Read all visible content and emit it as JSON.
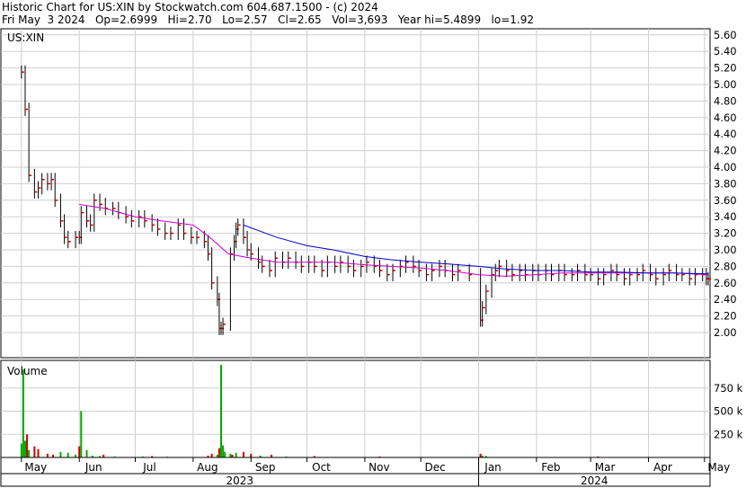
{
  "header": {
    "title_line": "Historic Chart for US:XIN by Stockwatch.com 604.687.1500 - (c) 2024",
    "quote_line": "Fri May  3 2024   Op=2.6999   Hi=2.70   Lo=2.57   Cl=2.65   Vol=3,693   Year hi=5.4899   lo=1.92"
  },
  "chart_data": [
    {
      "type": "line",
      "panel": "price",
      "title": "US:XIN",
      "ylim": [
        1.8,
        5.7
      ],
      "yticks": [
        "5.60",
        "5.40",
        "5.20",
        "5.00",
        "4.80",
        "4.60",
        "4.40",
        "4.20",
        "4.00",
        "3.80",
        "3.60",
        "3.40",
        "3.20",
        "3.00",
        "2.80",
        "2.60",
        "2.40",
        "2.20",
        "2.00"
      ],
      "grid": true,
      "x_months": [
        "May",
        "Jun",
        "Jul",
        "Aug",
        "Sep",
        "Oct",
        "Nov",
        "Dec",
        "Jan",
        "Feb",
        "Mar",
        "Apr",
        "May"
      ],
      "x_years": [
        "2023",
        "2024"
      ],
      "price_points": [
        [
          "2023-05-01",
          5.15
        ],
        [
          "2023-05-03",
          4.7
        ],
        [
          "2023-05-05",
          3.9
        ],
        [
          "2023-05-08",
          3.7
        ],
        [
          "2023-05-10",
          3.75
        ],
        [
          "2023-05-12",
          3.85
        ],
        [
          "2023-05-15",
          3.8
        ],
        [
          "2023-05-17",
          3.85
        ],
        [
          "2023-05-19",
          3.6
        ],
        [
          "2023-05-22",
          3.35
        ],
        [
          "2023-05-24",
          3.15
        ],
        [
          "2023-05-26",
          3.1
        ],
        [
          "2023-05-30",
          3.15
        ],
        [
          "2023-06-01",
          3.15
        ],
        [
          "2023-06-02",
          3.45
        ],
        [
          "2023-06-05",
          3.35
        ],
        [
          "2023-06-07",
          3.3
        ],
        [
          "2023-06-09",
          3.6
        ],
        [
          "2023-06-12",
          3.55
        ],
        [
          "2023-06-15",
          3.5
        ],
        [
          "2023-06-19",
          3.5
        ],
        [
          "2023-06-22",
          3.45
        ],
        [
          "2023-06-26",
          3.4
        ],
        [
          "2023-06-29",
          3.35
        ],
        [
          "2023-07-03",
          3.4
        ],
        [
          "2023-07-06",
          3.35
        ],
        [
          "2023-07-10",
          3.3
        ],
        [
          "2023-07-13",
          3.25
        ],
        [
          "2023-07-17",
          3.2
        ],
        [
          "2023-07-20",
          3.2
        ],
        [
          "2023-07-24",
          3.3
        ],
        [
          "2023-07-27",
          3.2
        ],
        [
          "2023-07-31",
          3.15
        ],
        [
          "2023-08-03",
          3.15
        ],
        [
          "2023-08-07",
          3.1
        ],
        [
          "2023-08-09",
          2.95
        ],
        [
          "2023-08-11",
          2.6
        ],
        [
          "2023-08-14",
          2.4
        ],
        [
          "2023-08-15",
          2.05
        ],
        [
          "2023-08-16",
          2.05
        ],
        [
          "2023-08-17",
          2.1
        ],
        [
          "2023-08-21",
          2.95
        ],
        [
          "2023-08-23",
          3.1
        ],
        [
          "2023-08-24",
          3.25
        ],
        [
          "2023-08-25",
          3.3
        ],
        [
          "2023-08-28",
          3.15
        ],
        [
          "2023-08-30",
          3.0
        ],
        [
          "2023-09-01",
          2.95
        ],
        [
          "2023-09-05",
          2.85
        ],
        [
          "2023-09-07",
          2.8
        ],
        [
          "2023-09-11",
          2.75
        ],
        [
          "2023-09-14",
          2.9
        ],
        [
          "2023-09-18",
          2.85
        ],
        [
          "2023-09-21",
          2.9
        ],
        [
          "2023-09-25",
          2.85
        ],
        [
          "2023-09-28",
          2.8
        ],
        [
          "2023-10-02",
          2.85
        ],
        [
          "2023-10-05",
          2.8
        ],
        [
          "2023-10-09",
          2.75
        ],
        [
          "2023-10-12",
          2.85
        ],
        [
          "2023-10-16",
          2.8
        ],
        [
          "2023-10-19",
          2.85
        ],
        [
          "2023-10-23",
          2.8
        ],
        [
          "2023-10-26",
          2.75
        ],
        [
          "2023-10-30",
          2.8
        ],
        [
          "2023-11-02",
          2.85
        ],
        [
          "2023-11-06",
          2.8
        ],
        [
          "2023-11-09",
          2.75
        ],
        [
          "2023-11-13",
          2.7
        ],
        [
          "2023-11-16",
          2.75
        ],
        [
          "2023-11-20",
          2.8
        ],
        [
          "2023-11-23",
          2.85
        ],
        [
          "2023-11-27",
          2.8
        ],
        [
          "2023-11-30",
          2.75
        ],
        [
          "2023-12-04",
          2.7
        ],
        [
          "2023-12-07",
          2.75
        ],
        [
          "2023-12-11",
          2.8
        ],
        [
          "2023-12-14",
          2.75
        ],
        [
          "2023-12-18",
          2.7
        ],
        [
          "2023-12-21",
          2.75
        ],
        [
          "2023-12-27",
          2.7
        ],
        [
          "2024-01-02",
          2.15
        ],
        [
          "2024-01-03",
          2.3
        ],
        [
          "2024-01-05",
          2.5
        ],
        [
          "2024-01-08",
          2.7
        ],
        [
          "2024-01-10",
          2.75
        ],
        [
          "2024-01-12",
          2.8
        ],
        [
          "2024-01-16",
          2.75
        ],
        [
          "2024-01-19",
          2.7
        ],
        [
          "2024-01-23",
          2.75
        ],
        [
          "2024-01-26",
          2.7
        ],
        [
          "2024-01-30",
          2.75
        ],
        [
          "2024-02-02",
          2.7
        ],
        [
          "2024-02-06",
          2.75
        ],
        [
          "2024-02-09",
          2.7
        ],
        [
          "2024-02-13",
          2.75
        ],
        [
          "2024-02-16",
          2.7
        ],
        [
          "2024-02-20",
          2.7
        ],
        [
          "2024-02-23",
          2.75
        ],
        [
          "2024-02-27",
          2.7
        ],
        [
          "2024-03-01",
          2.7
        ],
        [
          "2024-03-05",
          2.65
        ],
        [
          "2024-03-08",
          2.7
        ],
        [
          "2024-03-12",
          2.75
        ],
        [
          "2024-03-15",
          2.7
        ],
        [
          "2024-03-19",
          2.65
        ],
        [
          "2024-03-22",
          2.7
        ],
        [
          "2024-03-26",
          2.7
        ],
        [
          "2024-03-29",
          2.75
        ],
        [
          "2024-04-02",
          2.7
        ],
        [
          "2024-04-05",
          2.65
        ],
        [
          "2024-04-09",
          2.7
        ],
        [
          "2024-04-12",
          2.75
        ],
        [
          "2024-04-16",
          2.7
        ],
        [
          "2024-04-19",
          2.7
        ],
        [
          "2024-04-23",
          2.65
        ],
        [
          "2024-04-26",
          2.7
        ],
        [
          "2024-04-30",
          2.7
        ],
        [
          "2024-05-02",
          2.65
        ],
        [
          "2024-05-03",
          2.65
        ]
      ],
      "series": [
        {
          "color": "#cc00cc",
          "values": [
            [
              "2023-06-01",
              3.55
            ],
            [
              "2023-06-15",
              3.5
            ],
            [
              "2023-07-01",
              3.4
            ],
            [
              "2023-07-15",
              3.35
            ],
            [
              "2023-08-01",
              3.3
            ],
            [
              "2023-08-10",
              3.15
            ],
            [
              "2023-08-20",
              2.95
            ],
            [
              "2023-09-01",
              2.9
            ],
            [
              "2023-09-15",
              2.85
            ],
            [
              "2023-10-01",
              2.85
            ],
            [
              "2023-10-15",
              2.85
            ],
            [
              "2023-11-01",
              2.82
            ],
            [
              "2023-11-15",
              2.8
            ],
            [
              "2023-12-01",
              2.78
            ],
            [
              "2023-12-15",
              2.75
            ],
            [
              "2024-01-01",
              2.7
            ],
            [
              "2024-01-15",
              2.68
            ],
            [
              "2024-02-01",
              2.7
            ],
            [
              "2024-02-15",
              2.72
            ],
            [
              "2024-03-01",
              2.72
            ],
            [
              "2024-03-15",
              2.72
            ],
            [
              "2024-04-01",
              2.72
            ],
            [
              "2024-04-15",
              2.72
            ],
            [
              "2024-05-03",
              2.7
            ]
          ]
        },
        {
          "color": "#0000cc",
          "values": [
            [
              "2023-08-28",
              3.3
            ],
            [
              "2023-09-15",
              3.15
            ],
            [
              "2023-10-01",
              3.05
            ],
            [
              "2023-10-15",
              3.0
            ],
            [
              "2023-11-01",
              2.92
            ],
            [
              "2023-11-15",
              2.88
            ],
            [
              "2023-12-01",
              2.85
            ],
            [
              "2023-12-15",
              2.83
            ],
            [
              "2024-01-01",
              2.8
            ],
            [
              "2024-01-15",
              2.77
            ],
            [
              "2024-02-01",
              2.75
            ],
            [
              "2024-02-15",
              2.75
            ],
            [
              "2024-03-01",
              2.73
            ],
            [
              "2024-03-15",
              2.73
            ],
            [
              "2024-04-01",
              2.72
            ],
            [
              "2024-04-15",
              2.72
            ],
            [
              "2024-05-03",
              2.71
            ]
          ]
        }
      ]
    },
    {
      "type": "bar",
      "panel": "volume",
      "title": "Volume",
      "ylim": [
        0,
        1000000
      ],
      "yticks": [
        "750 k",
        "500 k",
        "250 k"
      ],
      "grid": true,
      "series": [
        {
          "color": "#00aa00",
          "values": [
            [
              "2023-05-01",
              150000
            ],
            [
              "2023-05-02",
              950000
            ],
            [
              "2023-05-03",
              180000
            ],
            [
              "2023-05-05",
              80000
            ],
            [
              "2023-05-22",
              60000
            ],
            [
              "2023-05-26",
              50000
            ],
            [
              "2023-05-30",
              30000
            ],
            [
              "2023-06-02",
              500000
            ],
            [
              "2023-06-05",
              80000
            ],
            [
              "2023-06-08",
              20000
            ],
            [
              "2023-06-12",
              15000
            ],
            [
              "2023-06-20",
              10000
            ],
            [
              "2023-07-05",
              10000
            ],
            [
              "2023-07-18",
              8000
            ],
            [
              "2023-08-14",
              30000
            ],
            [
              "2023-08-16",
              1000000
            ],
            [
              "2023-08-17",
              130000
            ],
            [
              "2023-08-18",
              60000
            ],
            [
              "2023-08-21",
              40000
            ],
            [
              "2023-08-24",
              50000
            ],
            [
              "2023-09-06",
              20000
            ],
            [
              "2023-09-20",
              10000
            ],
            [
              "2024-01-03",
              20000
            ],
            [
              "2024-01-05",
              15000
            ]
          ]
        },
        {
          "color": "#cc0000",
          "values": [
            [
              "2023-05-04",
              250000
            ],
            [
              "2023-05-08",
              120000
            ],
            [
              "2023-05-10",
              90000
            ],
            [
              "2023-05-15",
              40000
            ],
            [
              "2023-05-18",
              30000
            ],
            [
              "2023-06-01",
              120000
            ],
            [
              "2023-06-14",
              30000
            ],
            [
              "2023-07-10",
              15000
            ],
            [
              "2023-08-09",
              20000
            ],
            [
              "2023-08-11",
              40000
            ],
            [
              "2023-08-15",
              100000
            ],
            [
              "2023-08-22",
              30000
            ],
            [
              "2023-08-28",
              60000
            ],
            [
              "2023-09-01",
              40000
            ],
            [
              "2023-09-12",
              30000
            ],
            [
              "2023-10-05",
              15000
            ],
            [
              "2023-11-09",
              10000
            ],
            [
              "2024-01-02",
              40000
            ],
            [
              "2024-03-05",
              10000
            ],
            [
              "2024-05-02",
              5000
            ]
          ]
        }
      ]
    }
  ]
}
